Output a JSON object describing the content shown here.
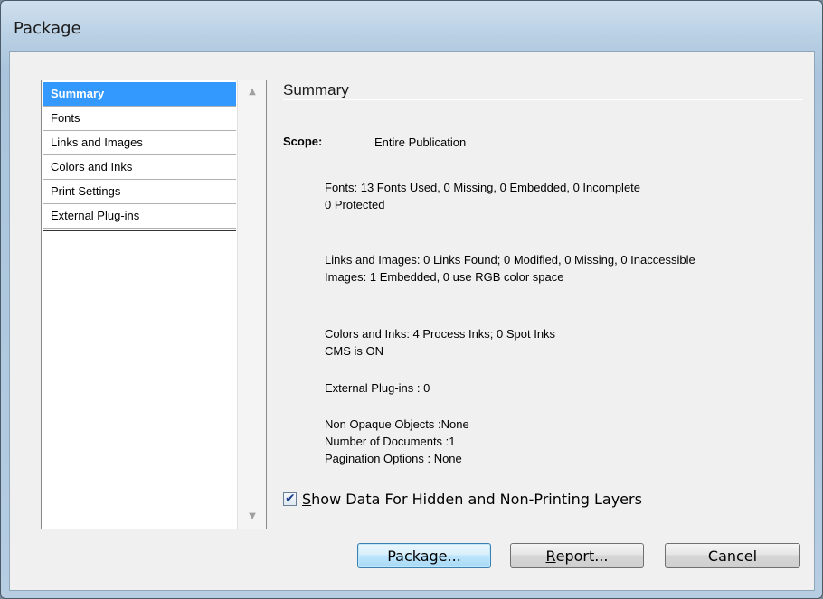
{
  "window": {
    "title": "Package"
  },
  "sidebar": {
    "items": [
      {
        "label": "Summary",
        "selected": true
      },
      {
        "label": "Fonts"
      },
      {
        "label": "Links and Images"
      },
      {
        "label": "Colors and Inks"
      },
      {
        "label": "Print Settings"
      },
      {
        "label": "External Plug-ins"
      }
    ]
  },
  "summary": {
    "heading": "Summary",
    "scope_label": "Scope:",
    "scope_value": "Entire Publication",
    "fonts_line1": "Fonts: 13 Fonts Used, 0 Missing, 0 Embedded, 0 Incomplete",
    "fonts_line2": "0 Protected",
    "links_line1": "Links and Images: 0 Links Found; 0 Modified, 0 Missing, 0 Inaccessible",
    "links_line2": "Images: 1 Embedded, 0 use RGB color space",
    "colors_line1": "Colors and Inks: 4 Process Inks; 0 Spot Inks",
    "colors_line2": "CMS is ON",
    "plugins_line": "External Plug-ins : 0",
    "opaque_line": "Non Opaque Objects :None",
    "documents_line": "Number of Documents :1",
    "pagination_line": "Pagination Options : None"
  },
  "options": {
    "show_hidden_checked": true,
    "show_hidden_mnemonic": "S",
    "show_hidden_rest": "how Data For Hidden and Non-Printing Layers"
  },
  "buttons": {
    "package_label": "Package...",
    "report_mnemonic": "R",
    "report_rest": "eport...",
    "cancel_label": "Cancel"
  }
}
